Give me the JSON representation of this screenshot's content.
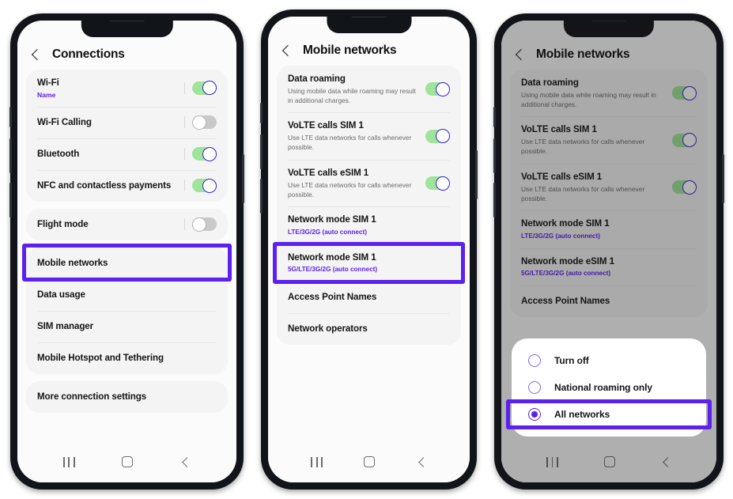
{
  "phones": {
    "phone1": {
      "appbar": {
        "title": "Connections",
        "back_icon": "back-chevron-icon"
      },
      "groups": [
        {
          "rows": [
            {
              "title": "Wi-Fi",
              "sub": "Name",
              "sub_style": "name",
              "control": "toggle",
              "state": "on"
            },
            {
              "title": "Wi-Fi Calling",
              "sub": "",
              "control": "toggle",
              "state": "off"
            },
            {
              "title": "Bluetooth",
              "sub": "",
              "control": "toggle",
              "state": "on"
            },
            {
              "title": "NFC and contactless payments",
              "sub": "",
              "control": "toggle",
              "state": "on"
            }
          ]
        },
        {
          "rows": [
            {
              "title": "Flight mode",
              "sub": "",
              "control": "toggle",
              "state": "off"
            }
          ]
        },
        {
          "highlighted": true,
          "rows": [
            {
              "title": "Mobile networks",
              "sub": "",
              "control": "none"
            },
            {
              "title": "Data usage",
              "sub": "",
              "control": "none"
            },
            {
              "title": "SIM manager",
              "sub": "",
              "control": "none"
            },
            {
              "title": "Mobile Hotspot and Tethering",
              "sub": "",
              "control": "none"
            }
          ]
        },
        {
          "rows": [
            {
              "title": "More connection settings",
              "sub": "",
              "control": "none"
            }
          ]
        }
      ]
    },
    "phone2": {
      "appbar": {
        "title": "Mobile networks",
        "back_icon": "back-chevron-icon"
      },
      "groups": [
        {
          "rows": [
            {
              "title": "Data roaming",
              "sub": "Using mobile data while roaming may result in additional charges.",
              "control": "toggle",
              "state": "on"
            },
            {
              "title": "VoLTE calls SIM 1",
              "sub": "Use LTE data networks for calls whenever possible.",
              "control": "toggle",
              "state": "on"
            },
            {
              "title": "VoLTE calls eSIM 1",
              "sub": "Use LTE data networks for calls whenever possible.",
              "control": "toggle",
              "state": "on"
            },
            {
              "title": "Network mode SIM 1",
              "sub": "LTE/3G/2G (auto connect)",
              "sub_style": "accent",
              "control": "none"
            },
            {
              "title": "Network mode SIM 1",
              "sub": "5G/LTE/3G/2G (auto connect)",
              "sub_style": "accent",
              "control": "none",
              "highlight": true
            },
            {
              "title": "Access Point Names",
              "sub": "",
              "control": "none"
            },
            {
              "title": "Network operators",
              "sub": "",
              "control": "none"
            }
          ]
        }
      ]
    },
    "phone3": {
      "appbar": {
        "title": "Mobile networks",
        "back_icon": "back-chevron-icon"
      },
      "dimmed": true,
      "groups": [
        {
          "rows": [
            {
              "title": "Data roaming",
              "sub": "Using mobile data while roaming may result in additional charges.",
              "control": "toggle",
              "state": "on"
            },
            {
              "title": "VoLTE calls SIM 1",
              "sub": "Use LTE data networks for calls whenever possible.",
              "control": "toggle",
              "state": "on"
            },
            {
              "title": "VoLTE calls eSIM 1",
              "sub": "Use LTE data networks for calls whenever possible.",
              "control": "toggle",
              "state": "on"
            },
            {
              "title": "Network mode SIM 1",
              "sub": "LTE/3G/2G (auto connect)",
              "sub_style": "accent",
              "control": "none"
            },
            {
              "title": "Network mode eSIM 1",
              "sub": "5G/LTE/3G/2G (auto connect)",
              "sub_style": "accent",
              "control": "none"
            },
            {
              "title": "Access Point Names",
              "sub": "",
              "control": "none"
            }
          ]
        }
      ],
      "dialog": {
        "options": [
          {
            "label": "Turn off",
            "selected": false
          },
          {
            "label": "National roaming only",
            "selected": false
          },
          {
            "label": "All networks",
            "selected": true,
            "highlight": true
          }
        ]
      }
    }
  },
  "navbar": {
    "recent_icon": "recent-apps-icon",
    "home_icon": "home-icon",
    "back_icon": "back-icon"
  },
  "colors": {
    "highlight": "#5a21f0",
    "accent_text": "#5a21e8",
    "toggle_on_track": "#9ee49a",
    "toggle_on_knob_border": "#3b21d6",
    "toggle_off_track": "#c9c9c9",
    "card_bg": "#f4f4f4",
    "screen_bg": "#fbfbfb",
    "frame": "#111418"
  }
}
